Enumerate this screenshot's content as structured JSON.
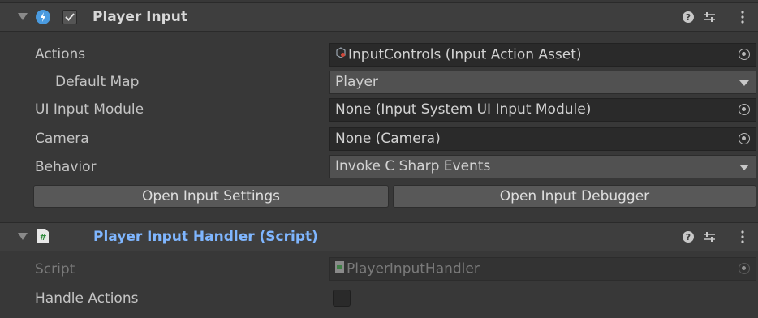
{
  "player_input": {
    "title": "Player Input",
    "enabled": true,
    "actions_label": "Actions",
    "actions_value": "InputControls (Input Action Asset)",
    "default_map_label": "Default Map",
    "default_map_value": "Player",
    "ui_input_module_label": "UI Input Module",
    "ui_input_module_value": "None (Input System UI Input Module)",
    "camera_label": "Camera",
    "camera_value": "None (Camera)",
    "behavior_label": "Behavior",
    "behavior_value": "Invoke C Sharp Events",
    "open_settings_label": "Open Input Settings",
    "open_debugger_label": "Open Input Debugger"
  },
  "handler": {
    "title": "Player Input Handler (Script)",
    "script_label": "Script",
    "script_value": "PlayerInputHandler",
    "handle_actions_label": "Handle Actions",
    "handle_actions_checked": false
  },
  "colors": {
    "background": "#383838",
    "header": "#3e3e3e",
    "script_title": "#7fb6ff",
    "field": "#2a2a2a",
    "dropdown": "#515151",
    "button": "#585858"
  },
  "icons": [
    "fold-arrow-icon",
    "input-system-icon",
    "checkbox-icon",
    "help-icon",
    "presets-icon",
    "kebab-menu-icon",
    "input-action-asset-icon",
    "object-picker-icon",
    "dropdown-arrow-icon",
    "script-file-icon"
  ]
}
